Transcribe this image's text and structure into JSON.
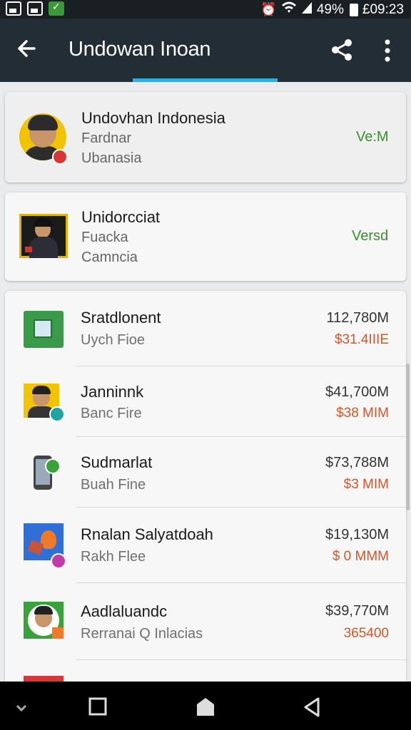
{
  "status_bar": {
    "battery": "49%",
    "time": "£09:23",
    "icons": [
      "photo-icon",
      "image-icon",
      "checkmark-app-icon",
      "alarm-icon",
      "wifi-icon",
      "signal-icon",
      "battery-icon"
    ]
  },
  "app_bar": {
    "title": "Undowan Inoan",
    "back_icon": "arrow-left-icon",
    "share_icon": "share-icon",
    "overflow_icon": "more-vertical-icon",
    "tab_indicator_color": "#3aa8e0"
  },
  "cards": [
    {
      "title": "Undovhan Indonesia",
      "line1": "Fardnar",
      "line2": "Ubanasia",
      "link": "Ve:M"
    },
    {
      "title": "Unidorcciat",
      "line1": "Fuacka",
      "line2": "Camncia",
      "link": "Versd"
    }
  ],
  "list": [
    {
      "title": "Sratdlonent",
      "subtitle": "Uych Fioe",
      "value": "112,780M",
      "change": "$31.4IIIE",
      "icon": "tablet-image-icon"
    },
    {
      "title": "Janninnk",
      "subtitle": "Banc Fire",
      "value": "$41,700M",
      "change": "$38 MIM",
      "icon": "person-avatar-icon"
    },
    {
      "title": "Sudmarlat",
      "subtitle": "Buah Fine",
      "value": "$73,788M",
      "change": "$3 MIM",
      "icon": "phone-icon"
    },
    {
      "title": "Rnalan Salyatdoah",
      "subtitle": "Rakh Flee",
      "value": "$19,130M",
      "change": "$  0 MMM",
      "icon": "fox-art-icon"
    },
    {
      "title": "Aadlaluandc",
      "subtitle": "Rerranai Q Inlacias",
      "value": "$39,770M",
      "change": "365400",
      "icon": "person-avatar-icon"
    }
  ],
  "colors": {
    "app_bar": "#232d35",
    "accent_green": "#3a8f2f",
    "accent_red": "#d2572a",
    "background": "#e9ebed"
  },
  "nav_bar": {
    "icons": [
      "chevron-down-icon",
      "square-icon",
      "home-icon",
      "back-triangle-icon"
    ]
  }
}
